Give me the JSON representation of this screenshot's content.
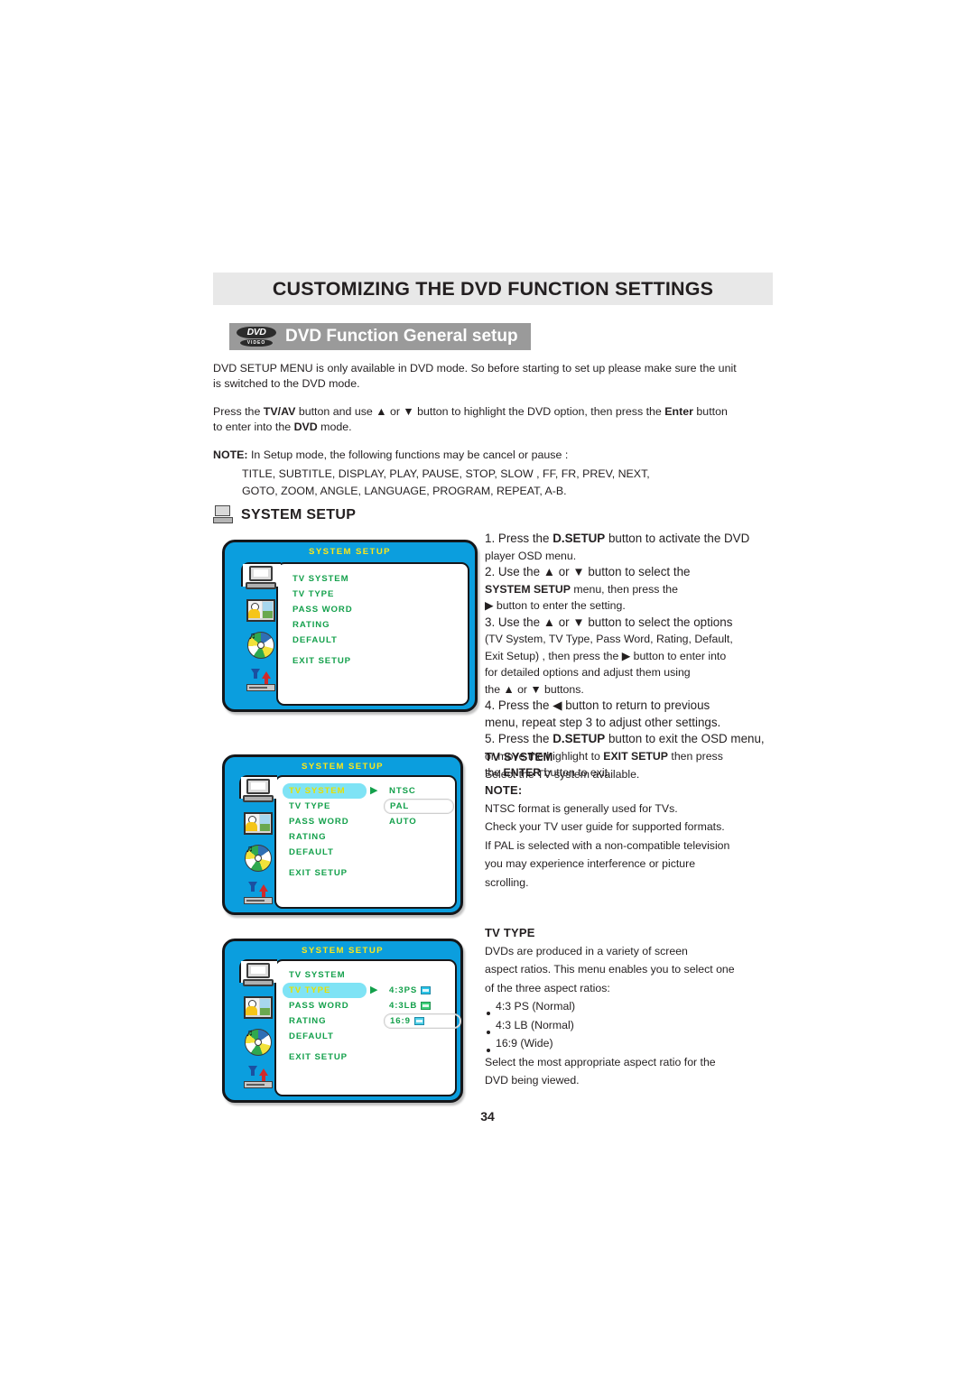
{
  "chapter": {
    "title": "CUSTOMIZING THE DVD FUNCTION SETTINGS"
  },
  "section": {
    "logo_top": "DVD",
    "logo_bottom": "VIDEO",
    "title": "DVD Function General setup"
  },
  "intro": {
    "p1_a": "DVD SETUP MENU is only available in DVD mode. So before starting to set up please make sure the unit",
    "p1_b": "is switched to the DVD mode.",
    "p2_pre": "Press the ",
    "p2_b1": "TV/AV",
    "p2_mid": " button and use ▲ or ▼ button to highlight the DVD option, then press the ",
    "p2_b2": "Enter",
    "p2_post": " button",
    "p2_line2_pre": "to enter into the ",
    "p2_b3": "DVD",
    "p2_line2_post": " mode.",
    "note_label": "NOTE:",
    "note_text": " In Setup mode, the following functions may be cancel or pause :",
    "note_line1": "TITLE, SUBTITLE, DISPLAY, PLAY, PAUSE, STOP, SLOW , FF, FR, PREV, NEXT,",
    "note_line2": "GOTO, ZOOM, ANGLE, LANGUAGE, PROGRAM, REPEAT, A-B."
  },
  "system_setup_heading": "SYSTEM SETUP",
  "osd": {
    "title": "SYSTEM SETUP",
    "menu_items": [
      "TV SYSTEM",
      "TV TYPE",
      "PASS WORD",
      "RATING",
      "DEFAULT",
      "EXIT SETUP"
    ],
    "cursor": "▶",
    "screen1": {
      "highlight": null,
      "options": []
    },
    "screen2": {
      "highlight": "TV SYSTEM",
      "options": [
        "NTSC",
        "PAL",
        "AUTO"
      ],
      "selected_option": "PAL"
    },
    "screen3": {
      "highlight": "TV TYPE",
      "options": [
        "4:3PS",
        "4:3LB",
        "16:9"
      ],
      "selected_option": "16:9"
    }
  },
  "steps": {
    "l1": "1. Press the ",
    "l1b": "D.SETUP",
    "l1c": " button to activate the DVD",
    "l2": "player OSD menu.",
    "l3": "2. Use the ▲ or ▼ button to select the",
    "l4b": "SYSTEM SETUP",
    "l4c": " menu, then press the",
    "l5": "▶ button to enter the setting.",
    "l6": "3. Use the ▲ or ▼ button to select the options",
    "l7": "(TV System, TV Type, Pass Word, Rating, Default,",
    "l8": "Exit Setup) , then press the ▶ button to enter into",
    "l9": "for detailed options and adjust them using",
    "l10": " the ▲ or ▼ buttons.",
    "l11": "4. Press the ◀ button to return to previous",
    "l12": "menu, repeat step 3 to adjust other settings.",
    "l13": "5. Press the ",
    "l13b": "D.SETUP",
    "l13c": " button to exit the OSD menu,",
    "l14": "or move the highlight to ",
    "l14b": "EXIT SETUP",
    "l14c": " then press",
    "l15": "the ",
    "l15b": "ENTER",
    "l15c": " button to exit."
  },
  "tv_system": {
    "heading": "TV SYSTEM",
    "line1": "Select the TV system available.",
    "note": "NOTE:",
    "line2": "NTSC format is generally used for TVs.",
    "line3": "Check your TV user guide for supported formats.",
    "line4": "If PAL is selected with a non-compatible television",
    "line5": "you may experience interference or picture",
    "line6": "scrolling."
  },
  "tv_type": {
    "heading": "TV TYPE",
    "line1": "DVDs are produced in a variety of screen",
    "line2": "aspect ratios. This menu enables you to select one",
    "line3": "of the three aspect ratios:",
    "bullets": [
      "4:3 PS (Normal)",
      "4:3 LB (Normal)",
      "16:9 (Wide)"
    ],
    "line4": "Select the most appropriate aspect ratio for the",
    "line5": "DVD being viewed."
  },
  "page_number": "34"
}
